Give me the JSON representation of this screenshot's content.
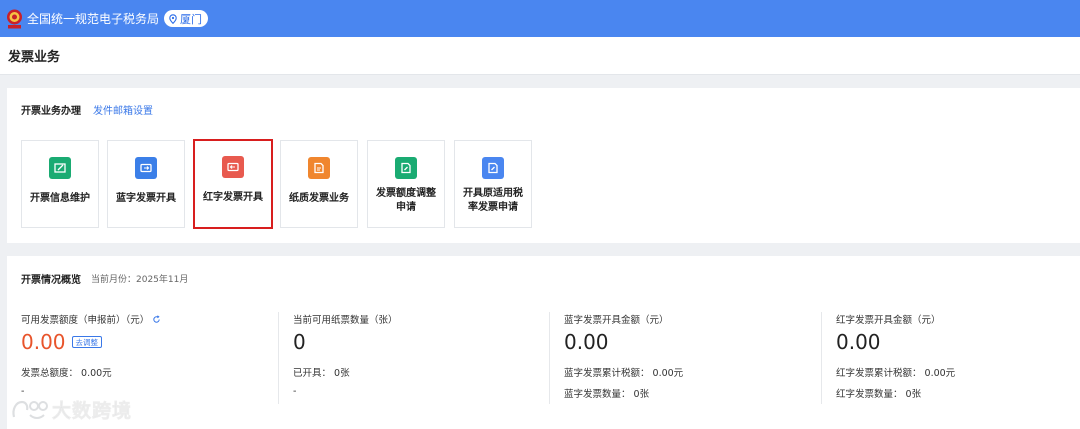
{
  "header": {
    "site_title": "全国统一规范电子税务局",
    "region": "厦门",
    "emblem_text": "税务"
  },
  "page": {
    "title": "发票业务"
  },
  "invoice_section": {
    "title": "开票业务办理",
    "link": "发件邮箱设置",
    "tiles": [
      {
        "label": "开票信息维护",
        "icon": "edit-frame-icon",
        "color": "#1aab72"
      },
      {
        "label": "蓝字发票开具",
        "icon": "invoice-ticket-icon",
        "color": "#3b7fe8"
      },
      {
        "label": "红字发票开具",
        "icon": "invoice-ticket-icon",
        "color": "#e85a4f"
      },
      {
        "label": "纸质发票业务",
        "icon": "paper-invoice-icon",
        "color": "#f0862e"
      },
      {
        "label": "发票额度调整申请",
        "icon": "edit-document-icon",
        "color": "#1aab72"
      },
      {
        "label": "开具原适用税率发票申请",
        "icon": "edit-document-icon",
        "color": "#4a86f0"
      }
    ]
  },
  "overview": {
    "title": "开票情况概览",
    "month": "当前月份：2025年11月",
    "stats": [
      {
        "label": "可用发票额度（申报前）（元）",
        "value": "0.00",
        "button": "去调整",
        "line1": "发票总额度：  0.00元",
        "line2": "-"
      },
      {
        "label": "当前可用纸票数量（张）",
        "value": "0",
        "line1": "已开具：  0张",
        "line2": "-"
      },
      {
        "label": "蓝字发票开具金额（元）",
        "value": "0.00",
        "line1": "蓝字发票累计税额：  0.00元",
        "line2": "蓝字发票数量：  0张"
      },
      {
        "label": "红字发票开具金额（元）",
        "value": "0.00",
        "line1": "红字发票累计税额：  0.00元",
        "line2": "红字发票数量：  0张"
      }
    ]
  },
  "watermark": {
    "text": "大数跨境"
  },
  "colors": {
    "brand_blue": "#4a86f0",
    "highlight_red": "#d81e1e",
    "value_red": "#e8542b",
    "link_blue": "#3a78e8"
  }
}
